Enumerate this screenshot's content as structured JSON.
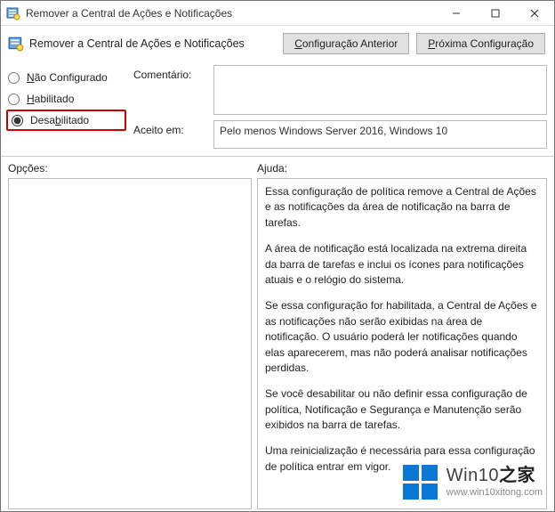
{
  "titlebar": {
    "title": "Remover a Central de Ações e Notificações"
  },
  "header": {
    "policy_title": "Remover a Central de Ações e Notificações",
    "prev_button": "Configuração Anterior",
    "next_button": "Próxima Configuração"
  },
  "radios": {
    "not_configured": "Não Configurado",
    "enabled": "Habilitado",
    "disabled": "Desabilitado",
    "selected": "disabled"
  },
  "fields": {
    "comment_label": "Comentário:",
    "comment_value": "",
    "supported_label": "Aceito em:",
    "supported_value": "Pelo menos Windows Server 2016, Windows 10"
  },
  "lower": {
    "options_label": "Opções:",
    "help_label": "Ajuda:"
  },
  "help": {
    "p1": "Essa configuração de política remove a Central de Ações e as notificações da área de notificação na barra de tarefas.",
    "p2": "A área de notificação está localizada na extrema direita da barra de tarefas e inclui os ícones para notificações atuais e o relógio do sistema.",
    "p3": "Se essa configuração for habilitada, a Central de Ações e as notificações não serão exibidas na área de notificação. O usuário poderá ler notificações quando elas aparecerem, mas não poderá analisar notificações perdidas.",
    "p4": "Se você desabilitar ou não definir essa configuração de política, Notificação e Segurança e Manutenção serão exibidos na barra de tarefas.",
    "p5": "Uma reinicialização é necessária para essa configuração de política entrar em vigor."
  },
  "watermark": {
    "brand_prefix": "Win10",
    "brand_suffix": "之家",
    "url": "www.win10xitong.com"
  }
}
